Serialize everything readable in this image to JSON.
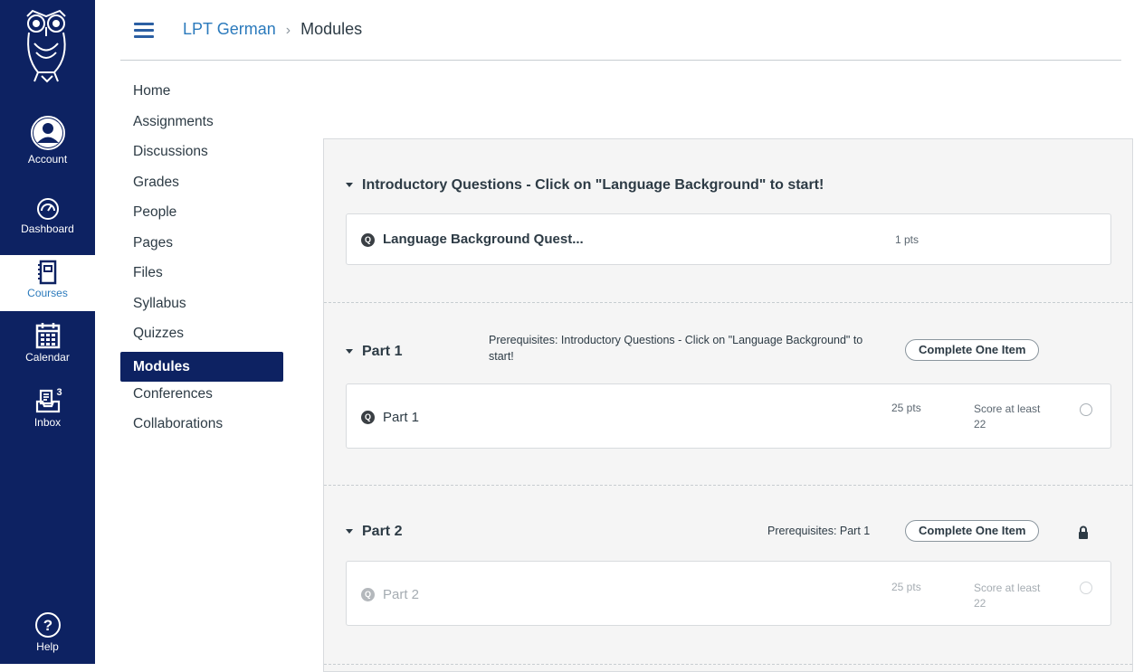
{
  "global_nav": {
    "items": [
      {
        "label": "Account",
        "icon": "account-icon"
      },
      {
        "label": "Dashboard",
        "icon": "dashboard-icon"
      },
      {
        "label": "Courses",
        "icon": "courses-icon"
      },
      {
        "label": "Calendar",
        "icon": "calendar-icon"
      },
      {
        "label": "Inbox",
        "icon": "inbox-icon",
        "badge": "3"
      },
      {
        "label": "Help",
        "icon": "help-icon"
      }
    ],
    "brand_color": "#0d2262"
  },
  "header": {
    "course_link": "LPT German",
    "separator": "›",
    "current": "Modules"
  },
  "course_nav": {
    "items": [
      "Home",
      "Assignments",
      "Discussions",
      "Grades",
      "People",
      "Pages",
      "Files",
      "Syllabus",
      "Quizzes",
      "Modules",
      "Conferences",
      "Collaborations"
    ],
    "active": "Modules"
  },
  "modules": [
    {
      "title": "Introductory Questions - Click on \"Language Background\" to start!",
      "items": [
        {
          "title": "Language Background Quest...",
          "points": "1 pts",
          "icon": "Q"
        }
      ]
    },
    {
      "title": "Part 1",
      "prerequisites": "Prerequisites: Introductory Questions - Click on \"Language Background\" to start!",
      "requirement": "Complete One Item",
      "items": [
        {
          "title": "Part 1",
          "points": "25 pts",
          "requirement": "Score at least 22",
          "icon": "Q"
        }
      ]
    },
    {
      "title": "Part 2",
      "prerequisites": "Prerequisites: Part 1",
      "requirement": "Complete One Item",
      "locked": true,
      "items": [
        {
          "title": "Part 2",
          "points": "25 pts",
          "requirement": "Score at least 22",
          "icon": "Q"
        }
      ]
    }
  ]
}
